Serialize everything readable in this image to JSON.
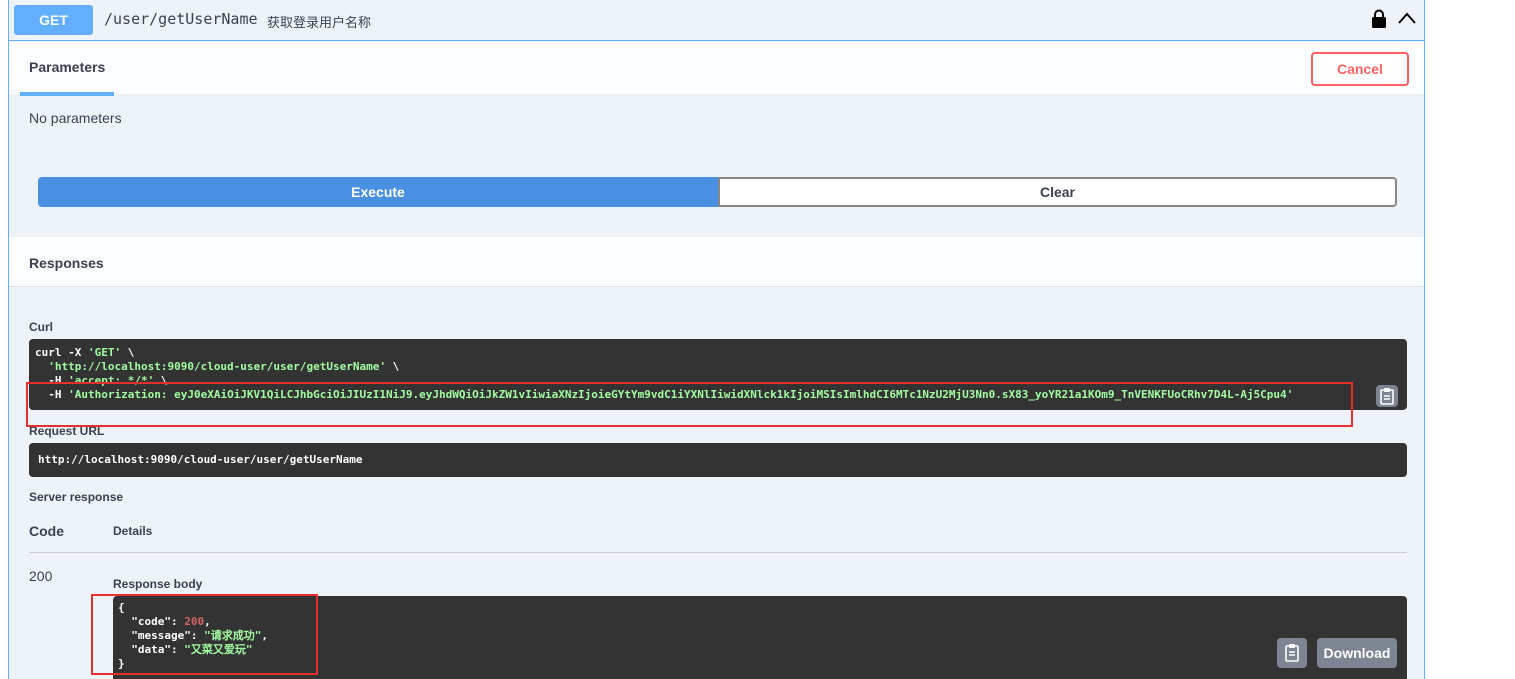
{
  "operation": {
    "method": "GET",
    "path": "/user/getUserName",
    "description": "获取登录用户名称"
  },
  "parameters": {
    "tab_label": "Parameters",
    "cancel_label": "Cancel",
    "empty_text": "No parameters"
  },
  "actions": {
    "execute_label": "Execute",
    "clear_label": "Clear"
  },
  "responses": {
    "title": "Responses",
    "curl_label": "Curl",
    "curl_lines": {
      "l1_prefix": "curl -X ",
      "l1_method": "'GET'",
      "l1_suffix": " \\",
      "l2_url": "'http://localhost:9090/cloud-user/user/getUserName'",
      "l2_suffix": " \\",
      "l3_prefix": "  -H ",
      "l3_header": "'accept: */*'",
      "l3_suffix": " \\",
      "l4_prefix": "  -H ",
      "l4_header": "'Authorization: eyJ0eXAiOiJKV1QiLCJhbGciOiJIUzI1NiJ9.eyJhdWQiOiJkZW1vIiwiaXNzIjoieGYtYm9vdC1iYXNlIiwidXNlck1kIjoiMSIsImlhdCI6MTc1NzU2MjU3Nn0.sX83_yoYR21a1KOm9_TnVENKFUoCRhv7D4L-Aj5Cpu4'"
    },
    "request_url_label": "Request URL",
    "request_url": "http://localhost:9090/cloud-user/user/getUserName",
    "server_response_label": "Server response",
    "code_header": "Code",
    "details_header": "Details",
    "status_code": "200",
    "response_body_label": "Response body",
    "body": {
      "open": "{",
      "code_key": "  \"code\": ",
      "code_val": "200",
      "code_comma": ",",
      "message_key": "  \"message\": ",
      "message_val": "\"请求成功\"",
      "message_comma": ",",
      "data_key": "  \"data\": ",
      "data_val": "\"又菜又爱玩\"",
      "close": "}"
    },
    "download_label": "Download"
  },
  "colors": {
    "get_method": "#61affe",
    "execute": "#4990e2",
    "cancel": "#ff6060",
    "code_bg": "#333333",
    "highlight": "#e53030"
  }
}
